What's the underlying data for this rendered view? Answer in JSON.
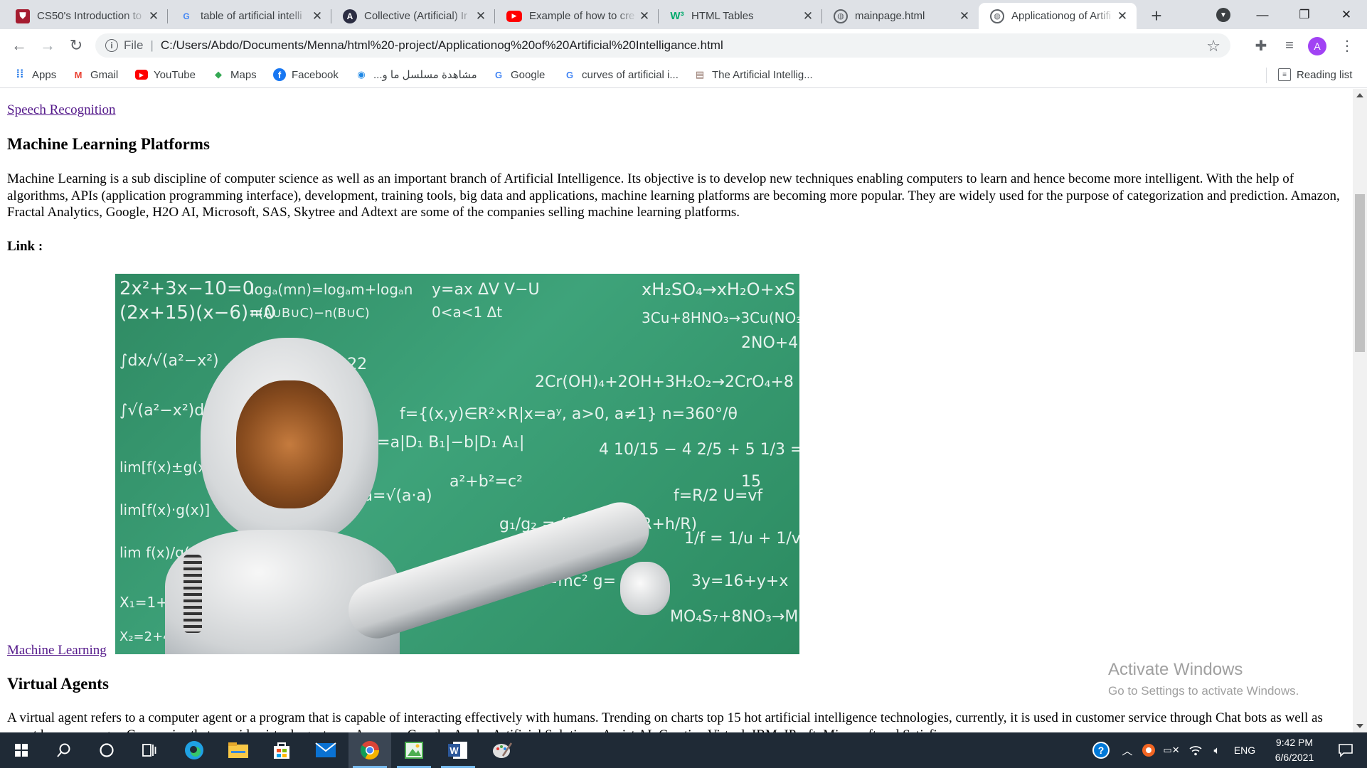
{
  "tabs": [
    {
      "title": "CS50's Introduction to",
      "favicon": "harvard-shield-icon",
      "color": "#a51c30",
      "active": false
    },
    {
      "title": "table of artificial intelli",
      "favicon": "google-g-icon",
      "color": "#4285f4",
      "active": false
    },
    {
      "title": "Collective (Artificial) Ir",
      "favicon": "letter-a-icon",
      "color": "#2b2d42",
      "active": false
    },
    {
      "title": "Example of how to cre",
      "favicon": "youtube-icon",
      "color": "#ff0000",
      "active": false
    },
    {
      "title": "HTML Tables",
      "favicon": "w3schools-icon",
      "color": "#04aa6d",
      "active": false
    },
    {
      "title": "mainpage.html",
      "favicon": "globe-icon",
      "color": "#5f6368",
      "active": false
    },
    {
      "title": "Applicationog of Artifi",
      "favicon": "globe-icon",
      "color": "#5f6368",
      "active": true
    }
  ],
  "address": {
    "scheme": "File",
    "url": "C:/Users/Abdo/Documents/Menna/html%20-project/Applicationog%20of%20Artificial%20Intelligance.html"
  },
  "profile_initial": "A",
  "bookmarks": [
    {
      "label": "Apps",
      "icon": "apps-grid-icon",
      "color": "#1a73e8"
    },
    {
      "label": "Gmail",
      "icon": "gmail-icon",
      "color": "#ea4335"
    },
    {
      "label": "YouTube",
      "icon": "youtube-icon",
      "color": "#ff0000"
    },
    {
      "label": "Maps",
      "icon": "maps-icon",
      "color": "#34a853"
    },
    {
      "label": "Facebook",
      "icon": "facebook-icon",
      "color": "#1877f2"
    },
    {
      "label": "مشاهدة مسلسل ما و...",
      "icon": "location-pin-icon",
      "color": "#1e88e5"
    },
    {
      "label": "Google",
      "icon": "google-g-icon",
      "color": "#4285f4"
    },
    {
      "label": "curves of artificial i...",
      "icon": "google-g-icon",
      "color": "#4285f4"
    },
    {
      "label": "The Artificial Intellig...",
      "icon": "site-icon",
      "color": "#8d6e63"
    }
  ],
  "reading_list": "Reading list",
  "page": {
    "link_top": "Speech Recognition",
    "heading1": "Machine Learning Platforms",
    "para1": "Machine Learning is a sub discipline of computer science as well as an important branch of Artificial Intelligence. Its objective is to develop new techniques enabling computers to learn and hence become more intelligent. With the help of algorithms, APIs (application programming interface), development, training tools, big data and applications, machine learning platforms are becoming more popular. They are widely used for the purpose of categorization and prediction. Amazon, Fractal Analytics, Google, H2O AI, Microsoft, SAS, Skytree and Adtext are some of the companies selling machine learning platforms.",
    "link_label": "Link :",
    "link_bottom": "Machine Learning",
    "heading2": "Virtual Agents",
    "para2": "A virtual agent refers to a computer agent or a program that is capable of interacting effectively with humans. Trending on charts top 15 hot artificial intelligence technologies, currently, it is used in customer service through Chat bots as well as smart home manager. Companies that provide virtual agents are Amazon, Google, Apple, Artificial Solutions, Assist AI, Creative Virtual, IBM, IPsoft, Microsoft and Satisfi."
  },
  "watermark": {
    "line1": "Activate Windows",
    "line2": "Go to Settings to activate Windows."
  },
  "taskbar": {
    "apps": [
      {
        "name": "start-icon"
      },
      {
        "name": "search-icon"
      },
      {
        "name": "cortana-icon"
      },
      {
        "name": "task-view-icon"
      },
      {
        "name": "edge-icon"
      },
      {
        "name": "file-explorer-icon"
      },
      {
        "name": "store-icon"
      },
      {
        "name": "mail-icon"
      },
      {
        "name": "chrome-icon"
      },
      {
        "name": "image-app-icon"
      },
      {
        "name": "word-icon"
      },
      {
        "name": "paint-icon"
      }
    ],
    "lang": "ENG",
    "time": "9:42 PM",
    "date": "6/6/2021"
  }
}
